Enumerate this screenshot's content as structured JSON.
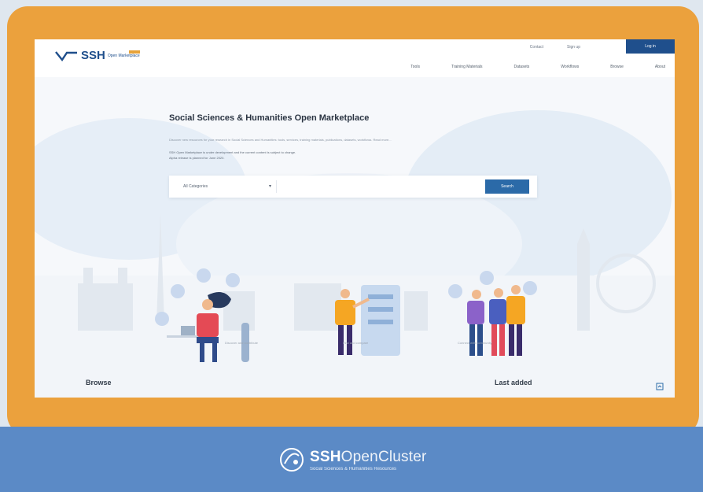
{
  "header": {
    "logo_text": "SSH",
    "logo_sub": "Open Marketplace",
    "top_links": [
      "Contact",
      "Sign up"
    ],
    "login": "Log in",
    "nav": [
      "Tools",
      "Training Materials",
      "Datasets",
      "Workflows",
      "Browse",
      "About"
    ]
  },
  "hero": {
    "title": "Social Sciences & Humanities Open Marketplace",
    "description": "Discover new resources for your research in Social Sciences and Humanities: tools, services, training materials, publications, datasets, workflows. Read more...",
    "note_line1": "SSH Open Marketplace is under development and the current content is subject to change.",
    "note_line2": "Alpha release is planned for June 2020."
  },
  "search": {
    "category_selected": "All Categories",
    "placeholder": "",
    "button": "Search"
  },
  "captions": [
    "Discover and contribute",
    "Find and compare",
    "Connect with community"
  ],
  "sections": {
    "browse": "Browse",
    "last_added": "Last added"
  },
  "footer": {
    "brand_bold": "SSH",
    "brand_light": "OpenCluster",
    "tagline": "Social Sciences & Humanities Resources"
  },
  "colors": {
    "frame": "#eba13d",
    "footer": "#5b8ac6",
    "primary": "#1f4f8c",
    "button": "#2b6aa8"
  },
  "icons": [
    "chevron-down-icon",
    "back-to-top-icon",
    "ssh-logo-icon",
    "sshopencluster-logo-icon"
  ]
}
